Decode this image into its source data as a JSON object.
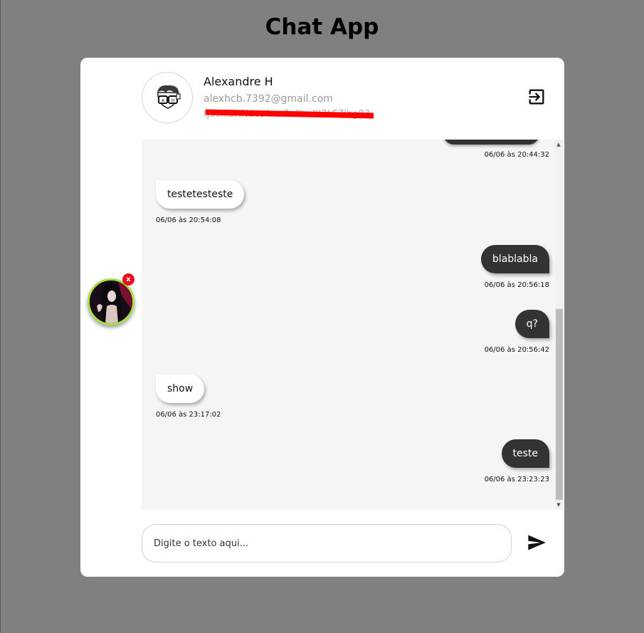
{
  "app": {
    "title": "Chat App"
  },
  "user": {
    "name": "Alexandre H",
    "email": "alexhcb.7392@gmail.com",
    "id": "fj9cxl3HNdcc4xw7e0hoXI7LS7lhg83"
  },
  "messages": [
    {
      "type": "sent",
      "text": "",
      "time": "06/06 às 20:44:32"
    },
    {
      "type": "received",
      "text": "testetesteste",
      "time": "06/06 às 20:54:08"
    },
    {
      "type": "sent",
      "text": "blablabla",
      "time": "06/06 às 20:56:18"
    },
    {
      "type": "sent",
      "text": "q?",
      "time": "06/06 às 20:56:42"
    },
    {
      "type": "received",
      "text": "show",
      "time": "06/06 às 23:17:02"
    },
    {
      "type": "sent",
      "text": "teste",
      "time": "06/06 às 23:23:23"
    }
  ],
  "composer": {
    "placeholder": "Digite o texto aqui...",
    "value": ""
  },
  "floating_chat": {
    "close_label": "x"
  },
  "icons": {
    "logout": "logout-icon",
    "send": "send-icon",
    "avatar": "nerd-glasses-avatar-icon"
  },
  "colors": {
    "page_bg": "#808080",
    "sent_bubble": "#333333",
    "received_bubble": "#ffffff",
    "chat_bg": "#f5f5f5",
    "floating_ring": "#a6e13f",
    "close_badge": "#e8101e",
    "redaction": "#ff0000"
  }
}
